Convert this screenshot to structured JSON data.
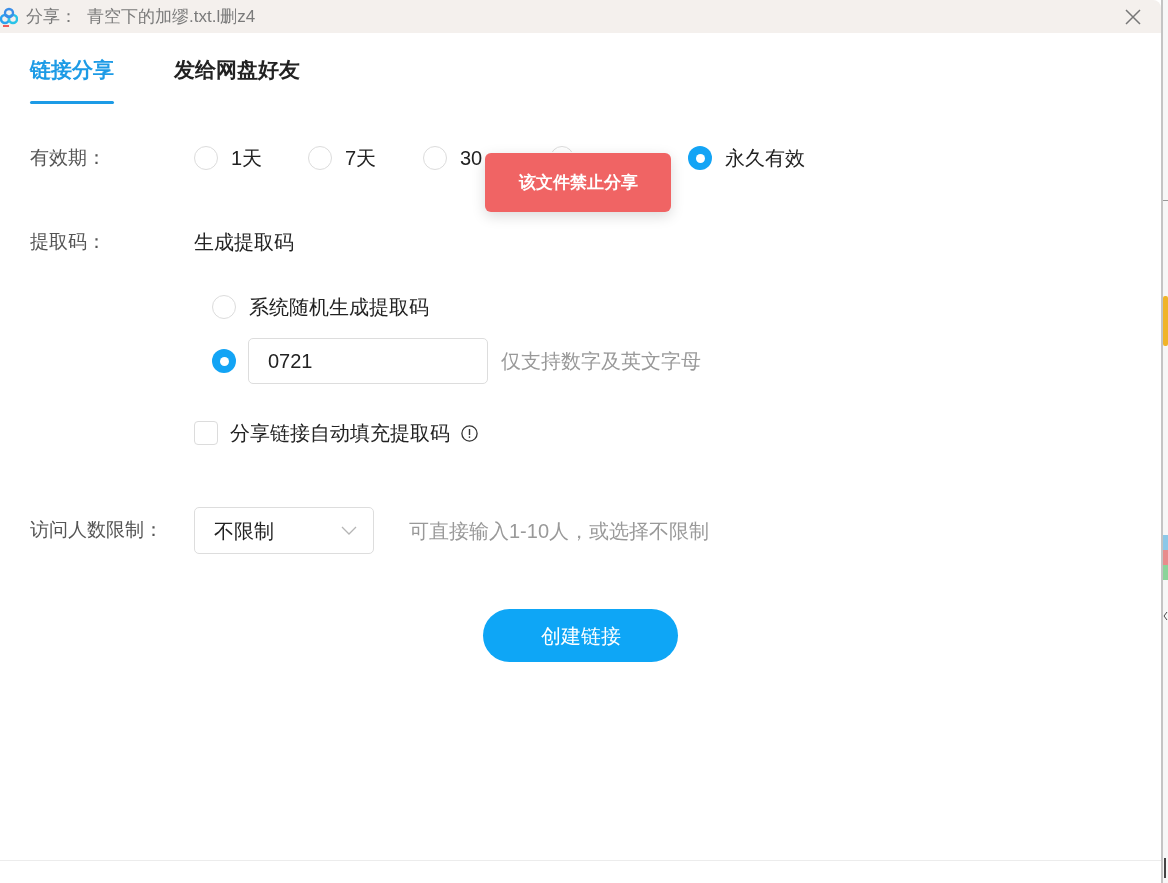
{
  "window": {
    "title": "分享：",
    "file_name": "青空下的加缪.txt.l删z4"
  },
  "tabs": [
    {
      "label": "链接分享",
      "selected": true
    },
    {
      "label": "发给网盘好友",
      "selected": false
    }
  ],
  "validity": {
    "label": "有效期：",
    "options": [
      {
        "label": "1天",
        "selected": false
      },
      {
        "label": "7天",
        "selected": false
      },
      {
        "label": "30",
        "selected": false
      },
      {
        "selected": false
      },
      {
        "label": "永久有效",
        "selected": true
      }
    ]
  },
  "toast": {
    "text": "该文件禁止分享"
  },
  "extraction_code": {
    "label": "提取码：",
    "heading": "生成提取码",
    "options": [
      {
        "kind": "random",
        "label": "系统随机生成提取码",
        "selected": false
      },
      {
        "kind": "custom",
        "value": "0721",
        "hint": "仅支持数字及英文字母",
        "selected": true
      }
    ],
    "auto_fill": {
      "label": "分享链接自动填充提取码",
      "checked": false
    }
  },
  "visitor_limit": {
    "label": "访问人数限制：",
    "value": "不限制",
    "hint": "可直接输入1-10人，或选择不限制"
  },
  "create_button": {
    "label": "创建链接"
  }
}
